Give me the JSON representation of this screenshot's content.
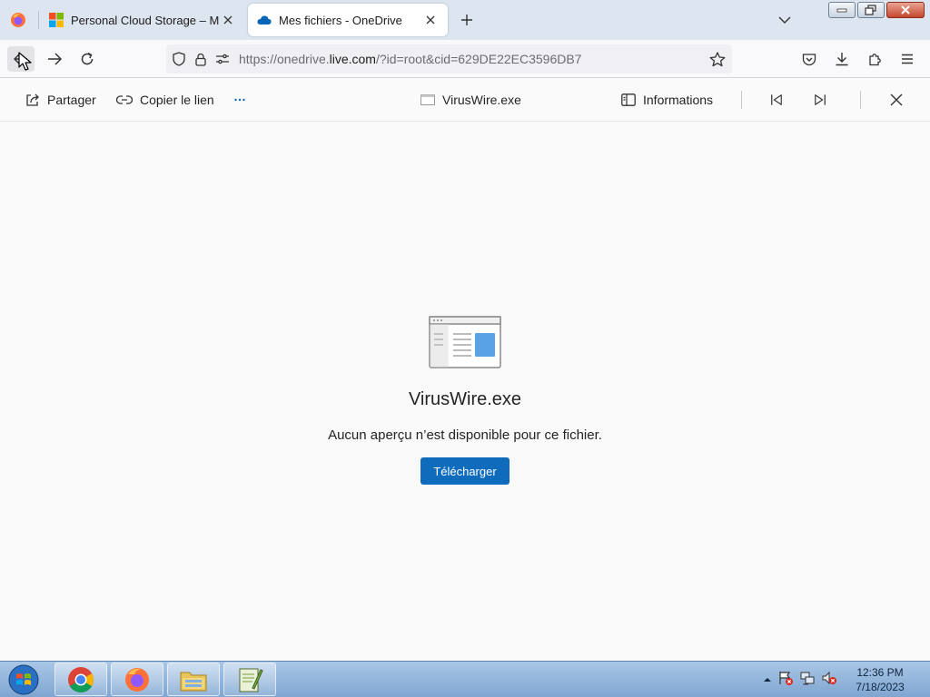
{
  "browser": {
    "tabs": [
      {
        "title": "Personal Cloud Storage – Micro",
        "active": false,
        "favicon": "microsoft-logo-icon"
      },
      {
        "title": "Mes fichiers - OneDrive",
        "active": true,
        "favicon": "onedrive-cloud-icon"
      }
    ],
    "url_prefix": "https://onedrive.",
    "url_domain": "live.com",
    "url_suffix": "/?id=root&cid=629DE22EC3596DB7"
  },
  "toolbar": {
    "share_label": "Partager",
    "copy_link_label": "Copier le lien",
    "more_label": "···",
    "file_name": "VirusWire.exe",
    "info_label": "Informations"
  },
  "preview": {
    "file_name": "VirusWire.exe",
    "message": "Aucun aperçu n’est disponible pour ce fichier.",
    "download_label": "Télécharger"
  },
  "colors": {
    "accent": "#0f6cbd",
    "onedrive": "#0364b8"
  },
  "taskbar": {
    "apps": [
      "chrome-icon",
      "firefox-icon",
      "file-explorer-icon",
      "notepadpp-icon"
    ],
    "time": "12:36 PM",
    "date": "7/18/2023"
  }
}
